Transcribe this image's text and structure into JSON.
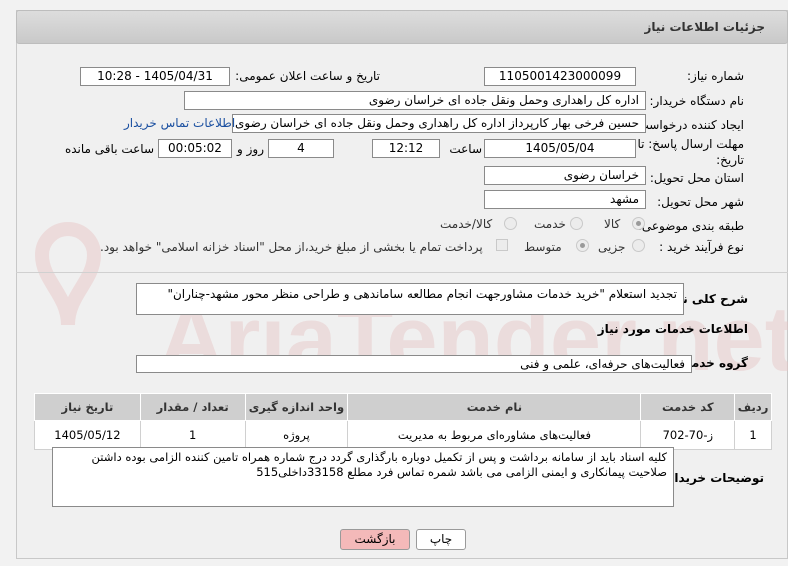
{
  "header": {
    "title": "جزئیات اطلاعات نیاز"
  },
  "form": {
    "need_number_label": "شماره نیاز:",
    "need_number": "1105001423000099",
    "announce_label": "تاریخ و ساعت اعلان عمومی:",
    "announce_value": "1405/04/31 - 10:28",
    "buyer_org_label": "نام دستگاه خریدار:",
    "buyer_org": "اداره کل راهداری وحمل ونقل جاده ای خراسان رضوی",
    "creator_label": "ایجاد کننده درخواست:",
    "creator": "حسین فرخی بهار کارپرداز اداره کل راهداری وحمل ونقل جاده ای خراسان رضوی",
    "contact_link": "اطلاعات تماس خریدار",
    "deadline_label": "مهلت ارسال پاسخ: تا تاریخ:",
    "deadline_date": "1405/05/04",
    "time_label": "ساعت",
    "deadline_time": "12:12",
    "days_value": "4",
    "days_label": "روز و",
    "remaining_time": "00:05:02",
    "remaining_label": "ساعت باقی مانده",
    "province_label": "استان محل تحویل:",
    "province": "خراسان رضوی",
    "city_label": "شهر محل تحویل:",
    "city": "مشهد",
    "category_label": "طبقه بندی موضوعی:",
    "category_options": [
      "کالا",
      "خدمت",
      "کالا/خدمت"
    ],
    "process_label": "نوع فرآیند خرید :",
    "process_options": [
      "جزیی",
      "متوسط"
    ],
    "payment_note": "پرداخت تمام یا بخشی از مبلغ خرید،از محل \"اسناد خزانه اسلامی\" خواهد بود."
  },
  "summary": {
    "label": "شرح کلی نیاز:",
    "text": "تجدید استعلام \"خرید خدمات مشاورجهت انجام مطالعه ساماندهی و طراحی منظر محور مشهد-چناران\""
  },
  "services": {
    "section_title": "اطلاعات خدمات مورد نیاز",
    "group_label": "گروه خدمت:",
    "group_value": "فعالیت‌های حرفه‌ای، علمی و فنی",
    "columns": [
      "ردیف",
      "کد خدمت",
      "نام خدمت",
      "واحد اندازه گیری",
      "تعداد / مقدار",
      "تاریخ نیاز"
    ],
    "rows": [
      [
        "1",
        "ز-70-702",
        "فعالیت‌های مشاوره‌ای مربوط به مدیریت",
        "پروژه",
        "1",
        "1405/05/12"
      ]
    ]
  },
  "notes": {
    "label": "توضیحات خریدار:",
    "line1": "کلیه اسناد باید از سامانه برداشت و پس از تکمیل دوباره بارگذاری گردد درج شماره همراه تامین کننده الزامی بوده داشتن",
    "line2": "صلاحیت پیمانکاری و ایمنی الزامی می باشد  شمره تماس فرد مطلع  33158داخلی515"
  },
  "buttons": {
    "print": "چاپ",
    "back": "بازگشت"
  },
  "watermark": {
    "text": "AriaTender.net"
  },
  "colors": {
    "back_button": "#f4b9b9",
    "link": "#1a4fa0",
    "watermark": "#e7c4c4"
  }
}
